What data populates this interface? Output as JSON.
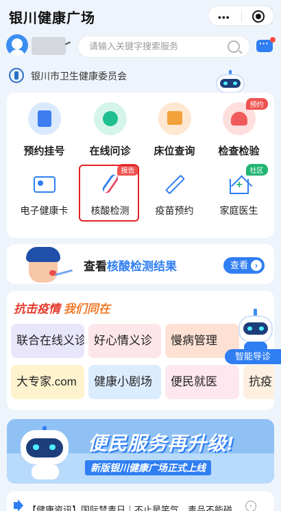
{
  "app": {
    "title": "银川健康广场",
    "more_glyph": "•••"
  },
  "search": {
    "placeholder": "请输入关键字搜索服务"
  },
  "org": {
    "name": "银川市卫生健康委员会"
  },
  "services_primary": [
    {
      "label": "预约挂号",
      "icon": "register-icon"
    },
    {
      "label": "在线问诊",
      "icon": "consult-icon"
    },
    {
      "label": "床位查询",
      "icon": "bed-icon"
    },
    {
      "label": "检查检验",
      "icon": "check-icon",
      "badge": "预约"
    }
  ],
  "services_secondary": [
    {
      "label": "电子健康卡",
      "icon": "health-card-icon"
    },
    {
      "label": "核酸检测",
      "icon": "dna-icon",
      "badge": "报告"
    },
    {
      "label": "疫苗预约",
      "icon": "syringe-icon"
    },
    {
      "label": "家庭医生",
      "icon": "home-doctor-icon",
      "badge": "社区"
    }
  ],
  "nucleic_banner": {
    "prefix": "查看",
    "highlight": "核酸检测结果",
    "button": "查看",
    "arrow": "›"
  },
  "epidemic": {
    "heading_a": "抗击疫情",
    "heading_b": "我们同在",
    "tiles": [
      "联合在线义诊",
      "好心情义诊",
      "慢病管理",
      "大专家.com",
      "健康小剧场",
      "便民就医",
      "抗疫"
    ]
  },
  "assistant": {
    "label": "智能导诊"
  },
  "upgrade_banner": {
    "headline": "便民服务再升级!",
    "subline": "新版银川健康广场正式上线"
  },
  "news": {
    "text": "【健康资讯】国际禁毒日｜不止是笑气，毒品不能碰，",
    "more": "›"
  },
  "colors": {
    "accent": "#2f7ef2",
    "alert": "#e02020",
    "background": "#eef4fb"
  }
}
